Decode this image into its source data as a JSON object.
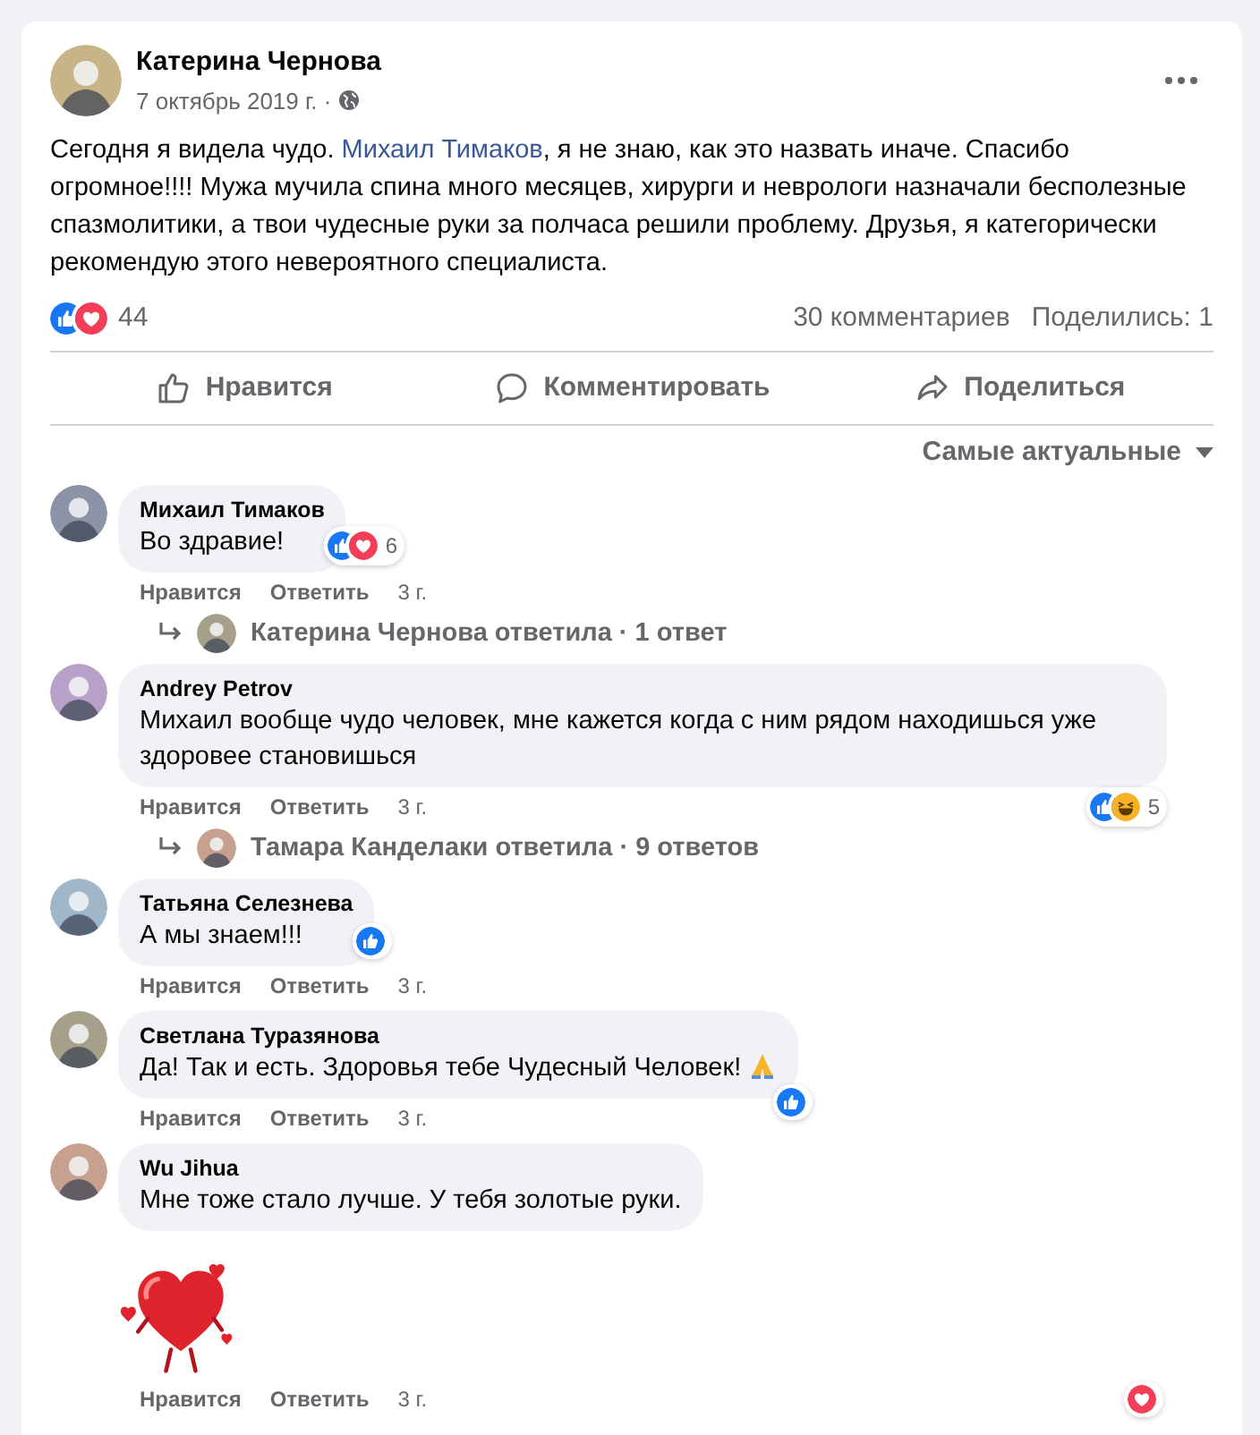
{
  "post": {
    "author": "Катерина Чернова",
    "date": "7 октябрь 2019 г. ·",
    "text": [
      {
        "kind": "text",
        "text": "Сегодня я видела чудо. "
      },
      {
        "kind": "link",
        "text": "Михаил Тимаков"
      },
      {
        "kind": "text",
        "text": ", я не знаю, как это назвать иначе. Спасибо огромное!!!! Мужа мучила спина много месяцев, хирурги и неврологи назначали бесполезные спазмолитики, а твои чудесные руки за полчаса решили проблему. Друзья, я категорически рекомендую этого невероятного специалиста."
      }
    ],
    "reactions": {
      "icons": [
        {
          "kind": "like"
        },
        {
          "kind": "love"
        }
      ],
      "count": "44"
    },
    "comments_count": "30 комментариев",
    "shares": "Поделились: 1",
    "actions": [
      {
        "kind": "like",
        "label": "Нравится"
      },
      {
        "kind": "comment",
        "label": "Комментировать"
      },
      {
        "kind": "share",
        "label": "Поделиться"
      }
    ],
    "sort": "Самые актуальные"
  },
  "comments": [
    {
      "author": "Михаил Тимаков",
      "text": "Во здравие!",
      "reactions": {
        "kind": "side",
        "icons": [
          {
            "kind": "like"
          },
          {
            "kind": "love"
          }
        ],
        "count": "6"
      },
      "actions": [
        "Нравится",
        "Ответить",
        "3 г."
      ],
      "replies": "Катерина Чернова ответила · 1 ответ"
    },
    {
      "author": "Andrey Petrov",
      "text": "Михаил вообще чудо человек, мне кажется когда с ним рядом находишься уже здоровее становишься",
      "reactions": {
        "kind": "below",
        "icons": [
          {
            "kind": "like"
          },
          {
            "kind": "haha"
          }
        ],
        "count": "5"
      },
      "actions": [
        "Нравится",
        "Ответить",
        "3 г."
      ],
      "replies": "Тамара Канделаки ответила · 9 ответов"
    },
    {
      "author": "Татьяна Селезнева",
      "text": "А мы знаем!!!",
      "reactions": {
        "kind": "side",
        "icons": [
          {
            "kind": "like"
          }
        ]
      },
      "actions": [
        "Нравится",
        "Ответить",
        "3 г."
      ]
    },
    {
      "author": "Светлана Туразянова",
      "text": "Да! Так и есть. Здоровья тебе Чудесный Человек!",
      "emoji": {
        "kind": "pray"
      },
      "reactions": {
        "kind": "corner",
        "icons": [
          {
            "kind": "like"
          }
        ]
      },
      "actions": [
        "Нравится",
        "Ответить",
        "3 г."
      ]
    },
    {
      "author": "Wu Jihua",
      "text": "Мне тоже стало лучше. У тебя золотые руки.",
      "sticker": {
        "kind": "heart"
      },
      "reactions": {
        "kind": "row",
        "icons": [
          {
            "kind": "love"
          }
        ]
      },
      "actions": [
        "Нравится",
        "Ответить",
        "3 г."
      ]
    }
  ]
}
